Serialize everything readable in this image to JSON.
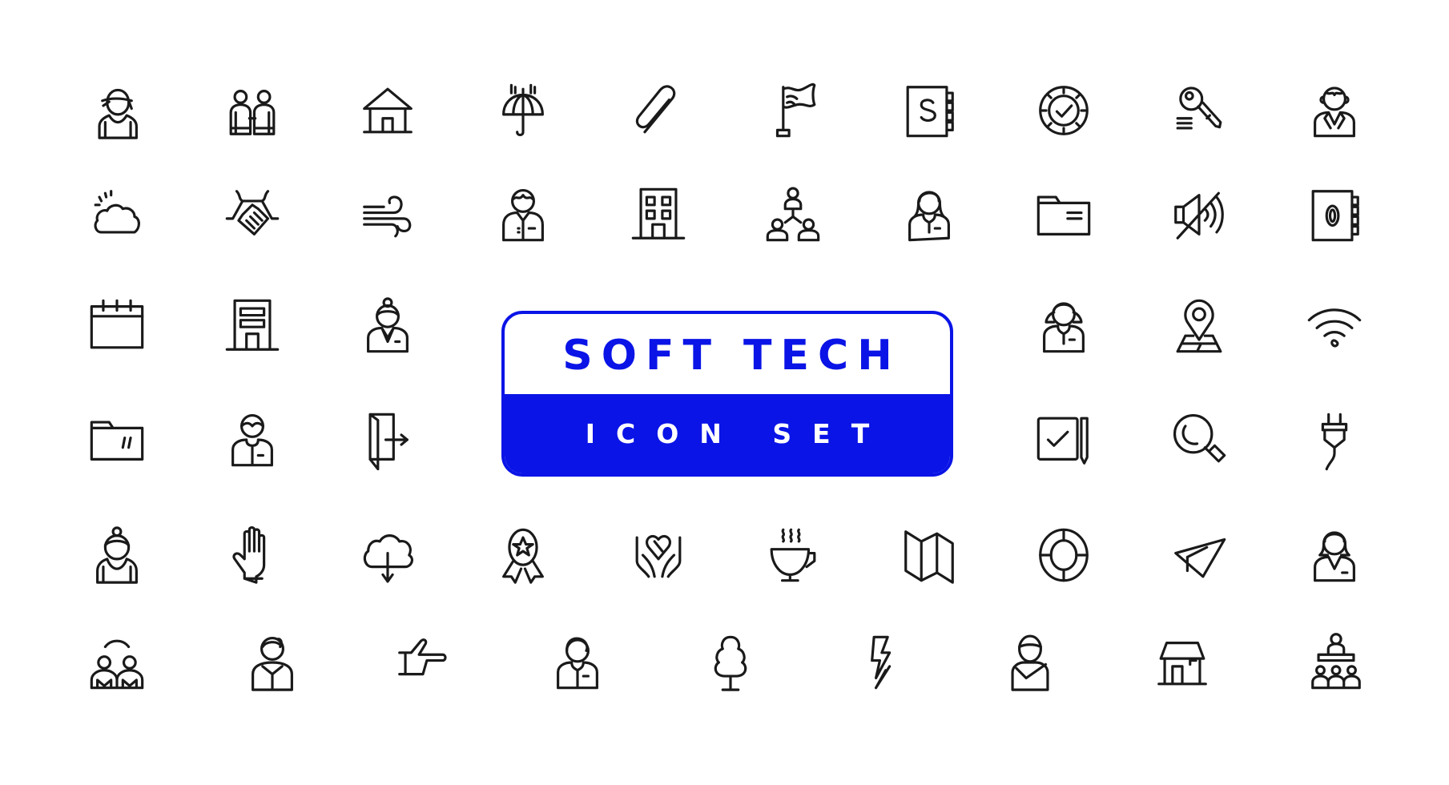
{
  "banner": {
    "title": "SOFT TECH",
    "subtitle": "ICON SET",
    "accent_color": "#0a14e6",
    "background_color": "#ffffff",
    "icon_stroke_color": "#1a1a1a"
  },
  "icon_rows": [
    [
      "woman-avatar",
      "two-people",
      "house",
      "umbrella-rain",
      "paperclip",
      "flag",
      "address-book-s",
      "approved-badge",
      "key",
      "man-avatar"
    ],
    [
      "cloud-sun",
      "handshake",
      "wind",
      "male-employee",
      "office-building",
      "team-hierarchy",
      "female-employee",
      "folder",
      "mute-speaker",
      "address-book-o"
    ],
    [
      "calendar",
      "building-facade",
      "elderly-woman",
      "female-receptionist",
      "map-pin",
      "wifi"
    ],
    [
      "folder-note",
      "male-worker",
      "exit-door",
      "checkbox-pencil",
      "magnifier",
      "power-plug"
    ],
    [
      "woman-bun",
      "raised-hand",
      "cloud-download",
      "award-ribbon",
      "caring-hands-heart",
      "hot-coffee-cup",
      "folded-map",
      "lifebuoy",
      "paper-plane",
      "businesswoman"
    ],
    [
      "people-connection",
      "woman-reading",
      "pointing-hand",
      "man-employee",
      "tree",
      "lightning",
      "person-hood",
      "shop",
      "presenter-audience"
    ]
  ]
}
